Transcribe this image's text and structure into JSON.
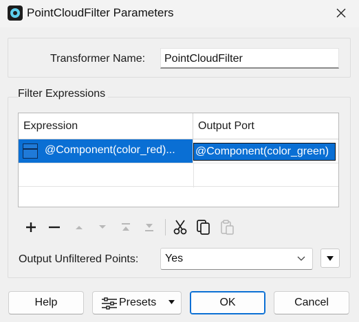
{
  "window": {
    "title": "PointCloudFilter Parameters",
    "icon": "app-icon",
    "close_icon": "close-icon"
  },
  "transformer": {
    "label": "Transformer Name:",
    "value": "PointCloudFilter"
  },
  "filter_expressions": {
    "title": "Filter Expressions",
    "columns": [
      "Expression",
      "Output Port"
    ],
    "rows": [
      {
        "expression": "@Component(color_red)...",
        "output_port": "@Component(color_green)"
      }
    ],
    "toolbar": [
      "plus-icon",
      "minus-icon",
      "move-up-icon",
      "move-down-icon",
      "move-top-icon",
      "move-bottom-icon",
      "cut-icon",
      "copy-icon",
      "paste-icon"
    ]
  },
  "output_unfiltered": {
    "label": "Output Unfiltered Points:",
    "value": "Yes"
  },
  "buttons": {
    "help": "Help",
    "presets": "Presets",
    "ok": "OK",
    "cancel": "Cancel"
  },
  "colors": {
    "selection": "#0a6fd4",
    "background": "#f0f0f0"
  }
}
